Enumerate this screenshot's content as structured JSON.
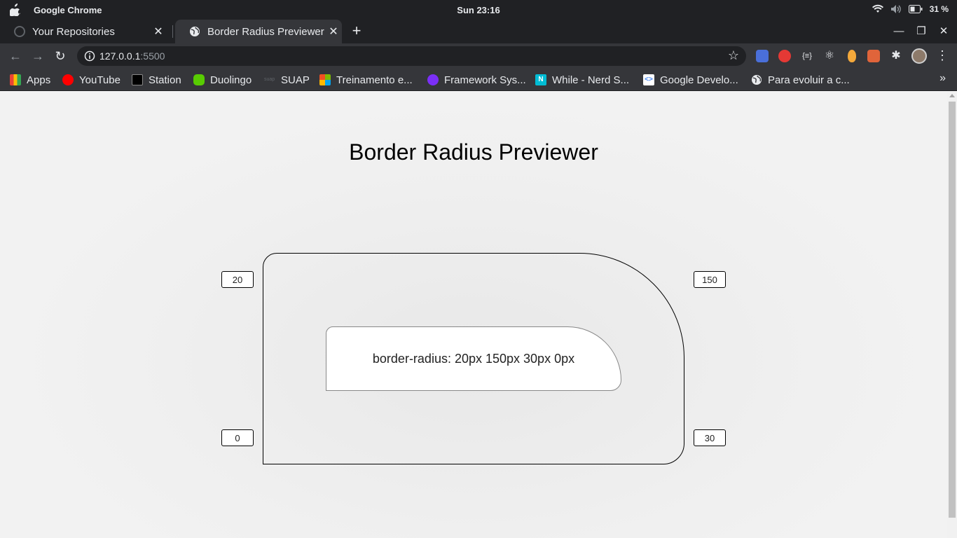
{
  "os": {
    "app_name": "Google Chrome",
    "clock": "Sun 23:16",
    "battery": "31 %"
  },
  "tabs": [
    {
      "title": "Your Repositories",
      "icon": "github-icon",
      "active": false
    },
    {
      "title": "Border Radius Previewer",
      "icon": "globe-icon",
      "active": true
    }
  ],
  "toolbar": {
    "url_host": "127.0.0.1",
    "url_port": ":5500"
  },
  "bookmarks": [
    {
      "label": "Apps",
      "icon": "apps-grid-icon",
      "color": "#4285f4"
    },
    {
      "label": "YouTube",
      "icon": "youtube-icon",
      "color": "#ff0000"
    },
    {
      "label": "Station",
      "icon": "station-icon",
      "color": "#000000"
    },
    {
      "label": "Duolingo",
      "icon": "duolingo-icon",
      "color": "#58cc02"
    },
    {
      "label": "SUAP",
      "icon": "suap-icon",
      "color": "#5f6368"
    },
    {
      "label": "Treinamento e...",
      "icon": "microsoft-icon",
      "color": "#f25022"
    },
    {
      "label": "Framework Sys...",
      "icon": "chat-bubble-icon",
      "color": "#7b2ff7"
    },
    {
      "label": "While - Nerd S...",
      "icon": "notion-icon",
      "color": "#00bcd4"
    },
    {
      "label": "Google Develo...",
      "icon": "google-developers-icon",
      "color": "#ffffff"
    },
    {
      "label": "Para evoluir a c...",
      "icon": "globe-icon",
      "color": "#e8eaed"
    }
  ],
  "page": {
    "title": "Border Radius Previewer",
    "radius": {
      "top_left": "20",
      "top_right": "150",
      "bottom_right": "30",
      "bottom_left": "0"
    },
    "code_text": "border-radius: 20px 150px 30px 0px"
  }
}
